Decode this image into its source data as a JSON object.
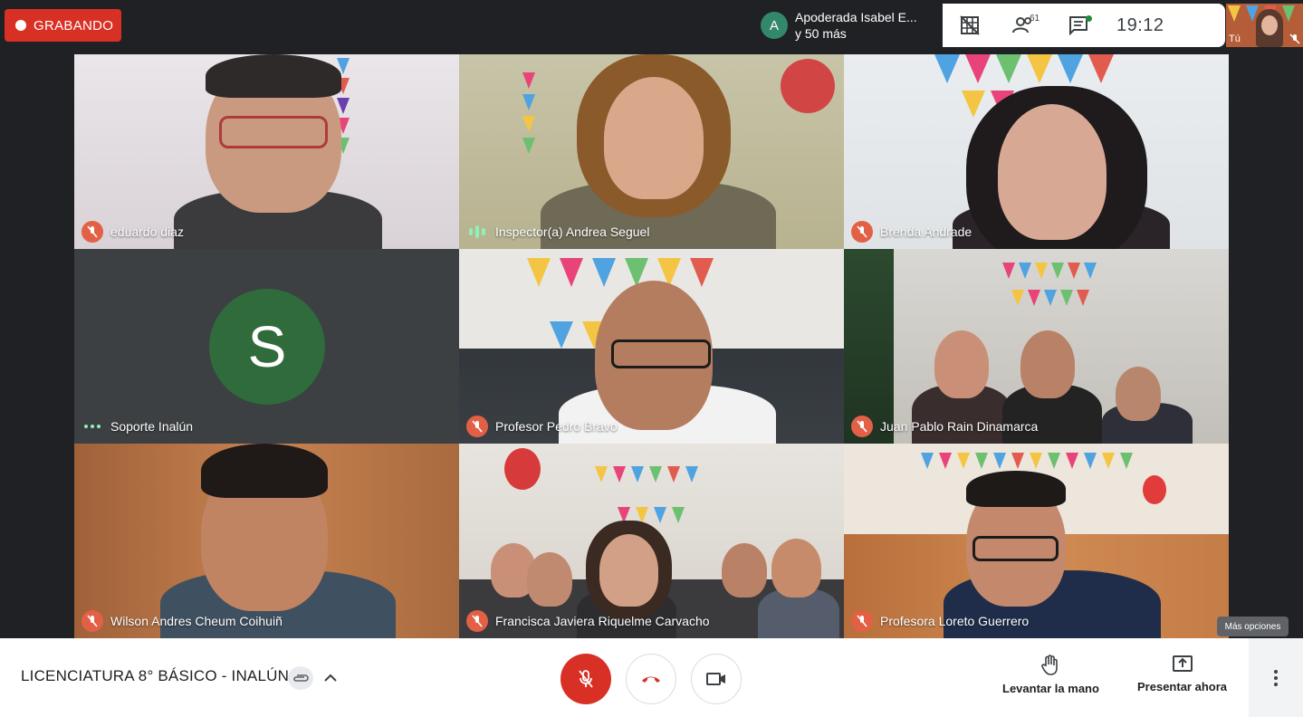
{
  "recording": {
    "label": "GRABANDO"
  },
  "notification": {
    "avatar_letter": "A",
    "line1": "Apoderada Isabel E...",
    "line2": "y 50 más"
  },
  "topbar": {
    "participants_count": "61",
    "time": "19:12",
    "layout_icon": "grid-off-icon",
    "people_icon": "people-icon",
    "chat_icon": "chat-icon"
  },
  "self_view": {
    "label": "Tú"
  },
  "tiles": [
    {
      "name": "eduardo diaz",
      "status": "muted"
    },
    {
      "name": "Inspector(a) Andrea Seguel",
      "status": "speaking"
    },
    {
      "name": "Brenda Andrade",
      "status": "muted"
    },
    {
      "name": "Soporte Inalún",
      "status": "idle",
      "avatar_letter": "S"
    },
    {
      "name": "Profesor Pedro Bravo",
      "status": "muted"
    },
    {
      "name": "Juan Pablo Rain Dinamarca",
      "status": "muted"
    },
    {
      "name": "Wilson Andres Cheum Coihuiñ",
      "status": "muted"
    },
    {
      "name": "Francisca Javiera Riquelme Carvacho",
      "status": "muted"
    },
    {
      "name": "Profesora Loreto Guerrero",
      "status": "muted"
    }
  ],
  "tooltip": {
    "label": "Más opciones"
  },
  "bottombar": {
    "meeting_title": "LICENCIATURA 8° BÁSICO - INALÚN",
    "raise_hand_label": "Levantar la mano",
    "present_label": "Presentar ahora"
  },
  "colors": {
    "accent_red": "#d93025",
    "tile_muted": "#e26045",
    "speaking_green": "#8ef1b8"
  }
}
